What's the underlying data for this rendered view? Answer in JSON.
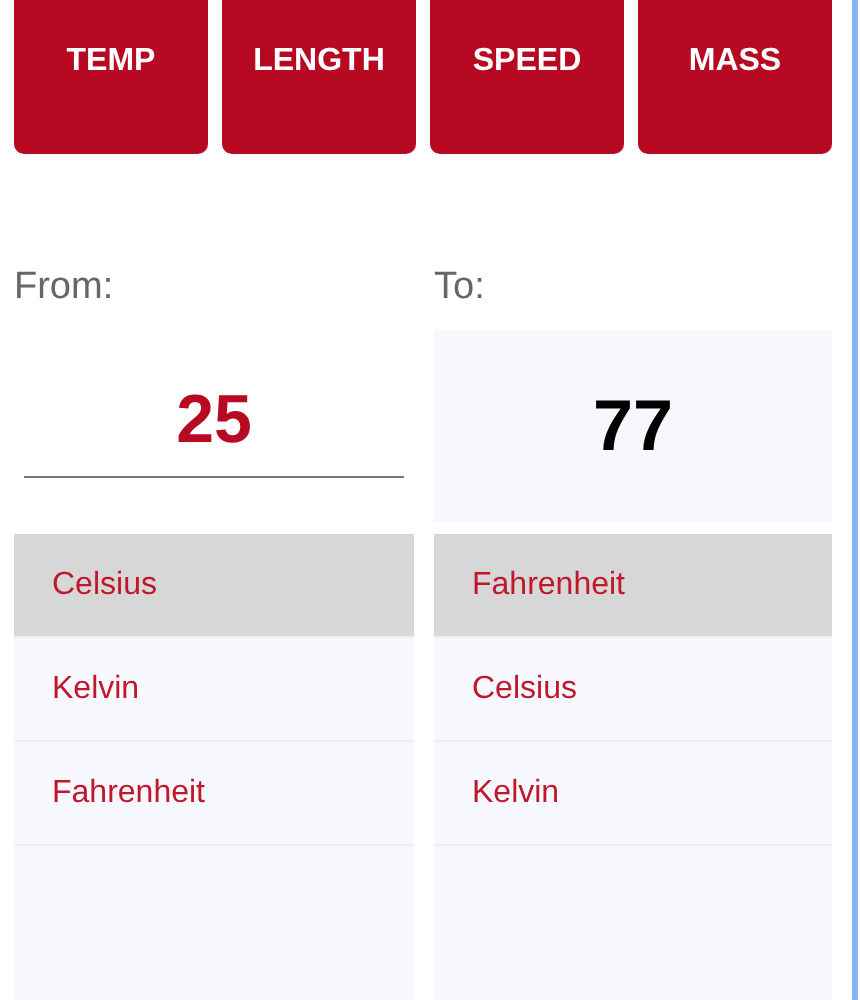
{
  "categories": [
    {
      "label": "TEMP"
    },
    {
      "label": "LENGTH"
    },
    {
      "label": "SPEED"
    },
    {
      "label": "MASS"
    }
  ],
  "from": {
    "label": "From:",
    "value": "25",
    "units": [
      {
        "name": "Celsius",
        "selected": true
      },
      {
        "name": "Kelvin",
        "selected": false
      },
      {
        "name": "Fahrenheit",
        "selected": false
      }
    ]
  },
  "to": {
    "label": "To:",
    "value": "77",
    "units": [
      {
        "name": "Fahrenheit",
        "selected": true
      },
      {
        "name": "Celsius",
        "selected": false
      },
      {
        "name": "Kelvin",
        "selected": false
      }
    ]
  }
}
